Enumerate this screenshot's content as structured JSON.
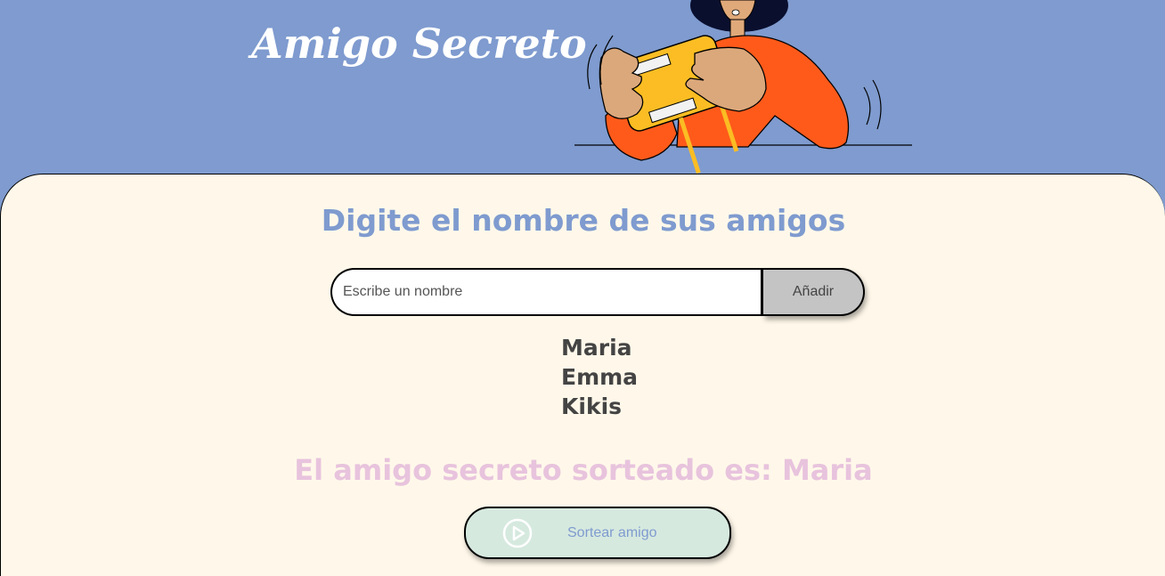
{
  "header": {
    "title": "Amigo Secreto",
    "illustration_icon": "person-with-gift-icon"
  },
  "main": {
    "section_title": "Digite el nombre de sus amigos",
    "name_input": {
      "value": "",
      "placeholder": "Escribe un nombre"
    },
    "add_button_label": "Añadir",
    "friends": [
      "Maria",
      "Emma",
      "Kikis"
    ],
    "result_text": "El amigo secreto sorteado es: Maria",
    "draw_button": {
      "label": "Sortear amigo",
      "icon": "play-circle-icon"
    }
  },
  "colors": {
    "header_bg": "#7f9bcf",
    "main_bg": "#fff8ea",
    "title_text": "#ffffff",
    "section_title": "#7f9bcf",
    "result_text": "#e8c3dd",
    "add_button_bg": "#c4c4c4",
    "draw_button_bg": "#d6e9df",
    "friend_text": "#444444"
  }
}
